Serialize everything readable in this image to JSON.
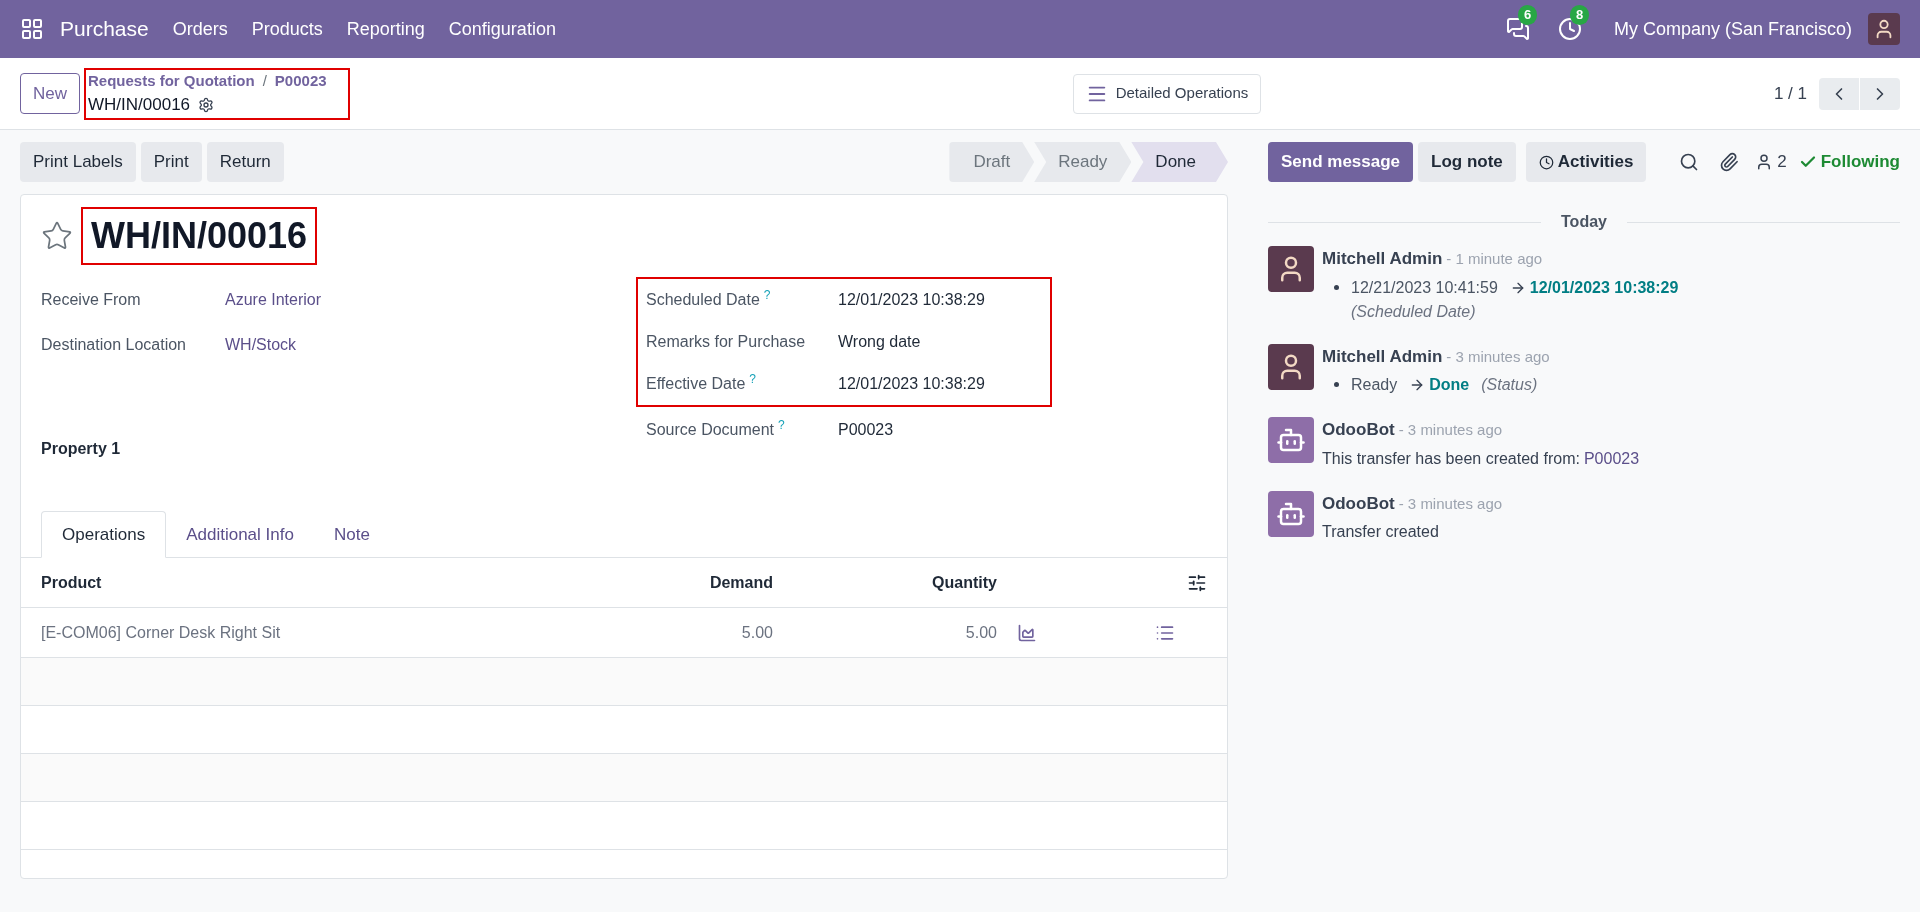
{
  "navbar": {
    "app": "Purchase",
    "menu": [
      "Orders",
      "Products",
      "Reporting",
      "Configuration"
    ],
    "messages_count": "6",
    "activities_count": "8",
    "company": "My Company (San Francisco)"
  },
  "control_panel": {
    "new_button": "New",
    "breadcrumb": {
      "highlighted": true,
      "parent": "Requests for Quotation",
      "separator": "/",
      "middle": "P00023",
      "current": "WH/IN/00016"
    },
    "center_button": "Detailed Operations",
    "pager": "1 / 1"
  },
  "actions": [
    "Print Labels",
    "Print",
    "Return"
  ],
  "status": [
    {
      "label": "Draft",
      "selected": false
    },
    {
      "label": "Ready",
      "selected": false
    },
    {
      "label": "Done",
      "selected": true
    }
  ],
  "form": {
    "starred": false,
    "title": {
      "text": "WH/IN/00016",
      "highlighted": true
    },
    "left_fields": [
      {
        "label": "Receive From",
        "value": "Azure Interior"
      },
      {
        "label": "Destination Location",
        "value": "WH/Stock"
      }
    ],
    "right_groups": [
      {
        "highlighted": true,
        "fields": [
          {
            "label": "Scheduled Date",
            "help": "?",
            "value": "12/01/2023 10:38:29"
          },
          {
            "label": "Remarks for Purchase",
            "value": "Wrong date"
          },
          {
            "label": "Effective Date",
            "help": "?",
            "value": "12/01/2023 10:38:29"
          }
        ]
      },
      {
        "highlighted": false,
        "fields": [
          {
            "label": "Source Document",
            "help": "?",
            "value": "P00023"
          }
        ]
      }
    ],
    "property": "Property 1",
    "tabs": [
      {
        "label": "Operations",
        "selected": true
      },
      {
        "label": "Additional Info",
        "selected": false
      },
      {
        "label": "Note",
        "selected": false
      }
    ],
    "table": {
      "columns": [
        "Product",
        "Demand",
        "Quantity"
      ],
      "rows": [
        {
          "product": "[E-COM06] Corner Desk Right Sit",
          "demand": "5.00",
          "quantity": "5.00"
        }
      ]
    }
  },
  "chatter": {
    "buttons": [
      {
        "label": "Send message",
        "kind": "primary"
      },
      {
        "label": "Log note",
        "kind": "secondary"
      },
      {
        "label": "Activities",
        "kind": "activities"
      }
    ],
    "followers": "2",
    "following": "Following",
    "day": "Today",
    "messages": [
      {
        "author": "Mitchell Admin",
        "avatar": {
          "kind": "user"
        },
        "time": "- 1 minute ago",
        "kind": "tracking",
        "old": "12/21/2023 10:41:59",
        "new": "12/01/2023 10:38:29",
        "field": "(Scheduled Date)"
      },
      {
        "author": "Mitchell Admin",
        "avatar": {
          "kind": "user"
        },
        "time": "- 3 minutes ago",
        "kind": "tracking",
        "old": "Ready",
        "new": "Done",
        "field": "(Status)"
      },
      {
        "author": "OdooBot",
        "avatar": {
          "kind": "bot"
        },
        "time": "- 3 minutes ago",
        "kind": "text",
        "body": "This transfer has been created from:",
        "link": "P00023"
      },
      {
        "author": "OdooBot",
        "avatar": {
          "kind": "bot"
        },
        "time": "- 3 minutes ago",
        "kind": "text",
        "body": "Transfer created"
      }
    ]
  }
}
